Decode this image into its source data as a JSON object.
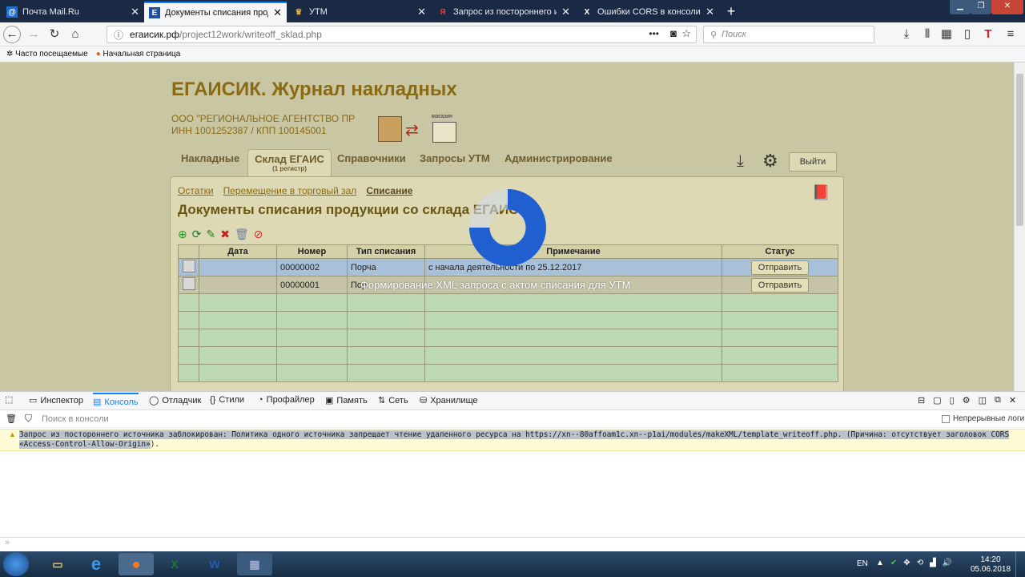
{
  "browser": {
    "tabs": [
      {
        "title": "Почта Mail.Ru",
        "icon": "mail-icon"
      },
      {
        "title": "Документы списания продукц",
        "icon": "egais-icon"
      },
      {
        "title": "УТМ",
        "icon": "emblem-icon"
      },
      {
        "title": "Запрос из постороннего исто",
        "icon": "yandex-icon"
      },
      {
        "title": "Ошибки CORS в консоли бра",
        "icon": "x-icon"
      }
    ],
    "new_tab": "+",
    "url_host": "егаисик.рф",
    "url_path": "/project12work/writeoff_sklad.php",
    "url_more": "•••",
    "search_placeholder": "Поиск",
    "bookmarks": [
      "Часто посещаемые",
      "Начальная страница"
    ]
  },
  "app": {
    "title": "ЕГАИСИК. Журнал накладных",
    "org_line1": "ООО \"РЕГИОНАЛЬНОЕ АГЕНТСТВО ПР",
    "org_line2": "ИНН 1001252387 / КПП 100145001",
    "logo_label": "магазин",
    "nav": [
      {
        "label": "Накладные",
        "sub": ""
      },
      {
        "label": "Склад ЕГАИС",
        "sub": "(1 регистр)"
      },
      {
        "label": "Справочники",
        "sub": ""
      },
      {
        "label": "Запросы УТМ",
        "sub": ""
      },
      {
        "label": "Администрирование",
        "sub": ""
      }
    ],
    "exit_label": "Выйти",
    "sublinks": [
      "Остатки",
      "Перемещение в торговый зал",
      "Списание"
    ],
    "heading": "Документы списания продукции со склада ЕГАИС",
    "columns": [
      "",
      "Дата",
      "Номер",
      "Тип списания",
      "Примечание",
      "Статус"
    ],
    "rows": [
      {
        "date": "",
        "number": "00000002",
        "type": "Порча",
        "note": "с начала деятельности по 25.12.2017",
        "status": "Отправить"
      },
      {
        "date": "",
        "number": "00000001",
        "type": "Пор",
        "note": "",
        "status": "Отправить"
      }
    ],
    "overlay_message": "Формирование XML запроса с актом списания для УТМ"
  },
  "devtools": {
    "tabs": [
      "Инспектор",
      "Консоль",
      "Отладчик",
      "Стили",
      "Профайлер",
      "Память",
      "Сеть",
      "Хранилище"
    ],
    "filter_placeholder": "Поиск в консоли",
    "persist_logs": "Непрерывные логи",
    "message_part1": "Запрос из постороннего источника заблокирован: Политика одного источника запрещает чтение удаленного ресурса на https://xn--80affoam1c.xn--p1ai/modules/makeXML/template_writeoff.php. (Причина: отсутствует заголовок CORS",
    "message_part2": "«Access-Control-Allow-Origin»",
    "message_part3": ").",
    "prompt": "»"
  },
  "taskbar": {
    "lang": "EN",
    "time": "14:20",
    "date": "05.06.2018"
  },
  "colors": {
    "page_bg": "#c9c6a4",
    "title_brown": "#8a6a12",
    "accent_blue": "#0a84ff",
    "spinner_blue": "#1f5fd0"
  }
}
